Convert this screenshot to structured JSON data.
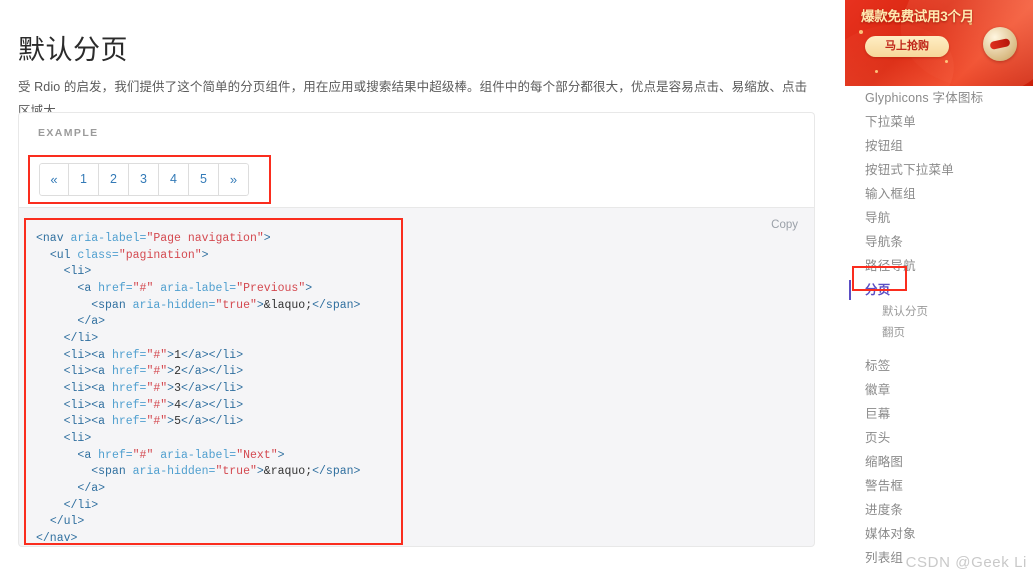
{
  "page": {
    "title": "默认分页",
    "lead": "受 Rdio 的启发，我们提供了这个简单的分页组件，用在应用或搜索结果中超级棒。组件中的每个部分都很大，优点是容易点击、易缩放、点击区域大。"
  },
  "example": {
    "label": "EXAMPLE",
    "copy_label": "Copy",
    "pagination": [
      {
        "label": "«",
        "name": "previous"
      },
      {
        "label": "1",
        "name": "page-1"
      },
      {
        "label": "2",
        "name": "page-2"
      },
      {
        "label": "3",
        "name": "page-3"
      },
      {
        "label": "4",
        "name": "page-4"
      },
      {
        "label": "5",
        "name": "page-5"
      },
      {
        "label": "»",
        "name": "next"
      }
    ]
  },
  "code": {
    "language": "html",
    "lines": [
      [
        {
          "t": "tag",
          "s": "<nav "
        },
        {
          "t": "attr",
          "s": "aria-label="
        },
        {
          "t": "val",
          "s": "\"Page navigation\""
        },
        {
          "t": "tag",
          "s": ">"
        }
      ],
      [
        {
          "t": "txt",
          "s": "  "
        },
        {
          "t": "tag",
          "s": "<ul "
        },
        {
          "t": "attr",
          "s": "class="
        },
        {
          "t": "val",
          "s": "\"pagination\""
        },
        {
          "t": "tag",
          "s": ">"
        }
      ],
      [
        {
          "t": "txt",
          "s": "    "
        },
        {
          "t": "tag",
          "s": "<li>"
        }
      ],
      [
        {
          "t": "txt",
          "s": "      "
        },
        {
          "t": "tag",
          "s": "<a "
        },
        {
          "t": "attr",
          "s": "href="
        },
        {
          "t": "val",
          "s": "\"#\""
        },
        {
          "t": "attr",
          "s": " aria-label="
        },
        {
          "t": "val",
          "s": "\"Previous\""
        },
        {
          "t": "tag",
          "s": ">"
        }
      ],
      [
        {
          "t": "txt",
          "s": "        "
        },
        {
          "t": "tag",
          "s": "<span "
        },
        {
          "t": "attr",
          "s": "aria-hidden="
        },
        {
          "t": "val",
          "s": "\"true\""
        },
        {
          "t": "tag",
          "s": ">"
        },
        {
          "t": "txt",
          "s": "&laquo;"
        },
        {
          "t": "tag",
          "s": "</span>"
        }
      ],
      [
        {
          "t": "txt",
          "s": "      "
        },
        {
          "t": "tag",
          "s": "</a>"
        }
      ],
      [
        {
          "t": "txt",
          "s": "    "
        },
        {
          "t": "tag",
          "s": "</li>"
        }
      ],
      [
        {
          "t": "txt",
          "s": "    "
        },
        {
          "t": "tag",
          "s": "<li>"
        },
        {
          "t": "tag",
          "s": "<a "
        },
        {
          "t": "attr",
          "s": "href="
        },
        {
          "t": "val",
          "s": "\"#\""
        },
        {
          "t": "tag",
          "s": ">"
        },
        {
          "t": "txt",
          "s": "1"
        },
        {
          "t": "tag",
          "s": "</a>"
        },
        {
          "t": "tag",
          "s": "</li>"
        }
      ],
      [
        {
          "t": "txt",
          "s": "    "
        },
        {
          "t": "tag",
          "s": "<li>"
        },
        {
          "t": "tag",
          "s": "<a "
        },
        {
          "t": "attr",
          "s": "href="
        },
        {
          "t": "val",
          "s": "\"#\""
        },
        {
          "t": "tag",
          "s": ">"
        },
        {
          "t": "txt",
          "s": "2"
        },
        {
          "t": "tag",
          "s": "</a>"
        },
        {
          "t": "tag",
          "s": "</li>"
        }
      ],
      [
        {
          "t": "txt",
          "s": "    "
        },
        {
          "t": "tag",
          "s": "<li>"
        },
        {
          "t": "tag",
          "s": "<a "
        },
        {
          "t": "attr",
          "s": "href="
        },
        {
          "t": "val",
          "s": "\"#\""
        },
        {
          "t": "tag",
          "s": ">"
        },
        {
          "t": "txt",
          "s": "3"
        },
        {
          "t": "tag",
          "s": "</a>"
        },
        {
          "t": "tag",
          "s": "</li>"
        }
      ],
      [
        {
          "t": "txt",
          "s": "    "
        },
        {
          "t": "tag",
          "s": "<li>"
        },
        {
          "t": "tag",
          "s": "<a "
        },
        {
          "t": "attr",
          "s": "href="
        },
        {
          "t": "val",
          "s": "\"#\""
        },
        {
          "t": "tag",
          "s": ">"
        },
        {
          "t": "txt",
          "s": "4"
        },
        {
          "t": "tag",
          "s": "</a>"
        },
        {
          "t": "tag",
          "s": "</li>"
        }
      ],
      [
        {
          "t": "txt",
          "s": "    "
        },
        {
          "t": "tag",
          "s": "<li>"
        },
        {
          "t": "tag",
          "s": "<a "
        },
        {
          "t": "attr",
          "s": "href="
        },
        {
          "t": "val",
          "s": "\"#\""
        },
        {
          "t": "tag",
          "s": ">"
        },
        {
          "t": "txt",
          "s": "5"
        },
        {
          "t": "tag",
          "s": "</a>"
        },
        {
          "t": "tag",
          "s": "</li>"
        }
      ],
      [
        {
          "t": "txt",
          "s": "    "
        },
        {
          "t": "tag",
          "s": "<li>"
        }
      ],
      [
        {
          "t": "txt",
          "s": "      "
        },
        {
          "t": "tag",
          "s": "<a "
        },
        {
          "t": "attr",
          "s": "href="
        },
        {
          "t": "val",
          "s": "\"#\""
        },
        {
          "t": "attr",
          "s": " aria-label="
        },
        {
          "t": "val",
          "s": "\"Next\""
        },
        {
          "t": "tag",
          "s": ">"
        }
      ],
      [
        {
          "t": "txt",
          "s": "        "
        },
        {
          "t": "tag",
          "s": "<span "
        },
        {
          "t": "attr",
          "s": "aria-hidden="
        },
        {
          "t": "val",
          "s": "\"true\""
        },
        {
          "t": "tag",
          "s": ">"
        },
        {
          "t": "txt",
          "s": "&raquo;"
        },
        {
          "t": "tag",
          "s": "</span>"
        }
      ],
      [
        {
          "t": "txt",
          "s": "      "
        },
        {
          "t": "tag",
          "s": "</a>"
        }
      ],
      [
        {
          "t": "txt",
          "s": "    "
        },
        {
          "t": "tag",
          "s": "</li>"
        }
      ],
      [
        {
          "t": "txt",
          "s": "  "
        },
        {
          "t": "tag",
          "s": "</ul>"
        }
      ],
      [
        {
          "t": "tag",
          "s": "</nav>"
        }
      ]
    ]
  },
  "sidebar": {
    "ad": {
      "title": "爆款免费试用3个月",
      "button_label": "马上抢购"
    },
    "nav": [
      {
        "label": "Glyphicons 字体图标",
        "type": "item",
        "active": false
      },
      {
        "label": "下拉菜单",
        "type": "item",
        "active": false
      },
      {
        "label": "按钮组",
        "type": "item",
        "active": false
      },
      {
        "label": "按钮式下拉菜单",
        "type": "item",
        "active": false
      },
      {
        "label": "输入框组",
        "type": "item",
        "active": false
      },
      {
        "label": "导航",
        "type": "item",
        "active": false
      },
      {
        "label": "导航条",
        "type": "item",
        "active": false
      },
      {
        "label": "路径导航",
        "type": "item",
        "active": false
      },
      {
        "label": "分页",
        "type": "item",
        "active": true
      },
      {
        "label": "默认分页",
        "type": "sub",
        "active": false
      },
      {
        "label": "翻页",
        "type": "sub",
        "active": false
      },
      {
        "label": "",
        "type": "gap",
        "active": false
      },
      {
        "label": "标签",
        "type": "item",
        "active": false
      },
      {
        "label": "徽章",
        "type": "item",
        "active": false
      },
      {
        "label": "巨幕",
        "type": "item",
        "active": false
      },
      {
        "label": "页头",
        "type": "item",
        "active": false
      },
      {
        "label": "缩略图",
        "type": "item",
        "active": false
      },
      {
        "label": "警告框",
        "type": "item",
        "active": false
      },
      {
        "label": "进度条",
        "type": "item",
        "active": false
      },
      {
        "label": "媒体对象",
        "type": "item",
        "active": false
      },
      {
        "label": "列表组",
        "type": "item",
        "active": false
      }
    ]
  },
  "watermark": "CSDN @Geek Li",
  "colors": {
    "link": "#337ab7",
    "annotation_red": "#fa2d1e",
    "active_nav": "#5b4ec4",
    "code_bg": "#f5f5f7"
  }
}
